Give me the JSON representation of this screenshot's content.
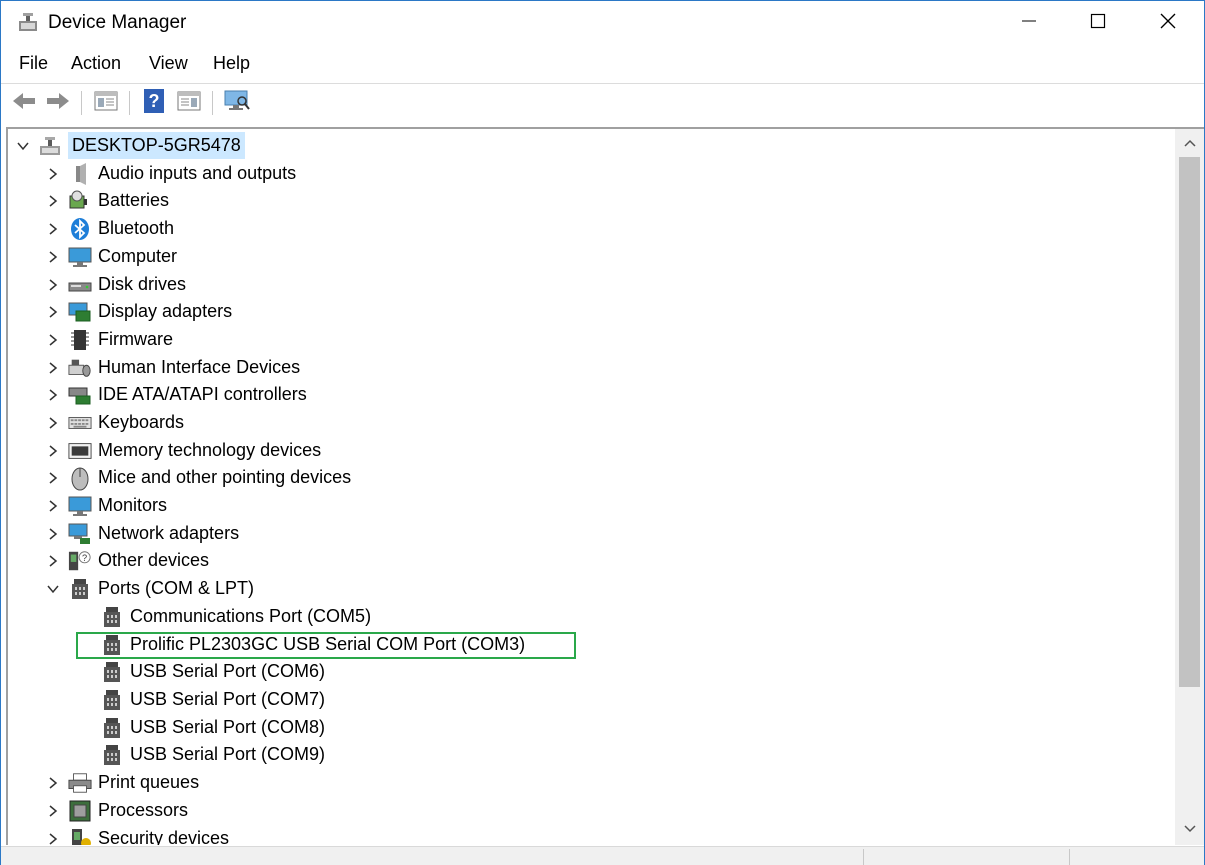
{
  "window": {
    "title": "Device Manager",
    "minimize_icon": "minimize-icon",
    "maximize_icon": "maximize-icon",
    "close_icon": "close-icon"
  },
  "menu": {
    "items": [
      {
        "label": "File"
      },
      {
        "label": "Action"
      },
      {
        "label": "View"
      },
      {
        "label": "Help"
      }
    ]
  },
  "toolbar": {
    "buttons": [
      {
        "icon": "back-arrow-icon"
      },
      {
        "icon": "forward-arrow-icon"
      },
      {
        "icon": "show-hide-console-tree-icon"
      },
      {
        "icon": "help-icon"
      },
      {
        "icon": "properties-icon"
      },
      {
        "icon": "scan-hardware-icon"
      }
    ]
  },
  "tree": {
    "root": {
      "label": "DESKTOP-5GR5478",
      "icon": "computer-network-icon"
    },
    "categories": [
      {
        "label": "Audio inputs and outputs",
        "icon": "speaker-icon"
      },
      {
        "label": "Batteries",
        "icon": "battery-icon"
      },
      {
        "label": "Bluetooth",
        "icon": "bluetooth-icon"
      },
      {
        "label": "Computer",
        "icon": "monitor-icon"
      },
      {
        "label": "Disk drives",
        "icon": "disk-drive-icon"
      },
      {
        "label": "Display adapters",
        "icon": "display-adapter-icon"
      },
      {
        "label": "Firmware",
        "icon": "chip-icon"
      },
      {
        "label": "Human Interface Devices",
        "icon": "hid-icon"
      },
      {
        "label": "IDE ATA/ATAPI controllers",
        "icon": "ide-controller-icon"
      },
      {
        "label": "Keyboards",
        "icon": "keyboard-icon"
      },
      {
        "label": "Memory technology devices",
        "icon": "memory-icon"
      },
      {
        "label": "Mice and other pointing devices",
        "icon": "mouse-icon"
      },
      {
        "label": "Monitors",
        "icon": "monitor-icon"
      },
      {
        "label": "Network adapters",
        "icon": "network-adapter-icon"
      },
      {
        "label": "Other devices",
        "icon": "unknown-device-icon"
      },
      {
        "label": "Ports (COM & LPT)",
        "icon": "port-icon",
        "expanded": true
      }
    ],
    "ports": [
      {
        "label": "Communications Port (COM5)",
        "icon": "port-icon"
      },
      {
        "label": "Prolific PL2303GC USB Serial COM Port (COM3)",
        "icon": "port-icon",
        "highlighted": true
      },
      {
        "label": "USB Serial Port (COM6)",
        "icon": "port-icon"
      },
      {
        "label": "USB Serial Port (COM7)",
        "icon": "port-icon"
      },
      {
        "label": "USB Serial Port (COM8)",
        "icon": "port-icon"
      },
      {
        "label": "USB Serial Port (COM9)",
        "icon": "port-icon"
      }
    ],
    "after_ports": [
      {
        "label": "Print queues",
        "icon": "printer-icon"
      },
      {
        "label": "Processors",
        "icon": "processor-icon"
      },
      {
        "label": "Security devices",
        "icon": "security-device-icon"
      }
    ]
  },
  "colors": {
    "highlight_border": "#2aa84a",
    "root_selection": "#cce8ff",
    "window_border": "#2b78c6"
  }
}
